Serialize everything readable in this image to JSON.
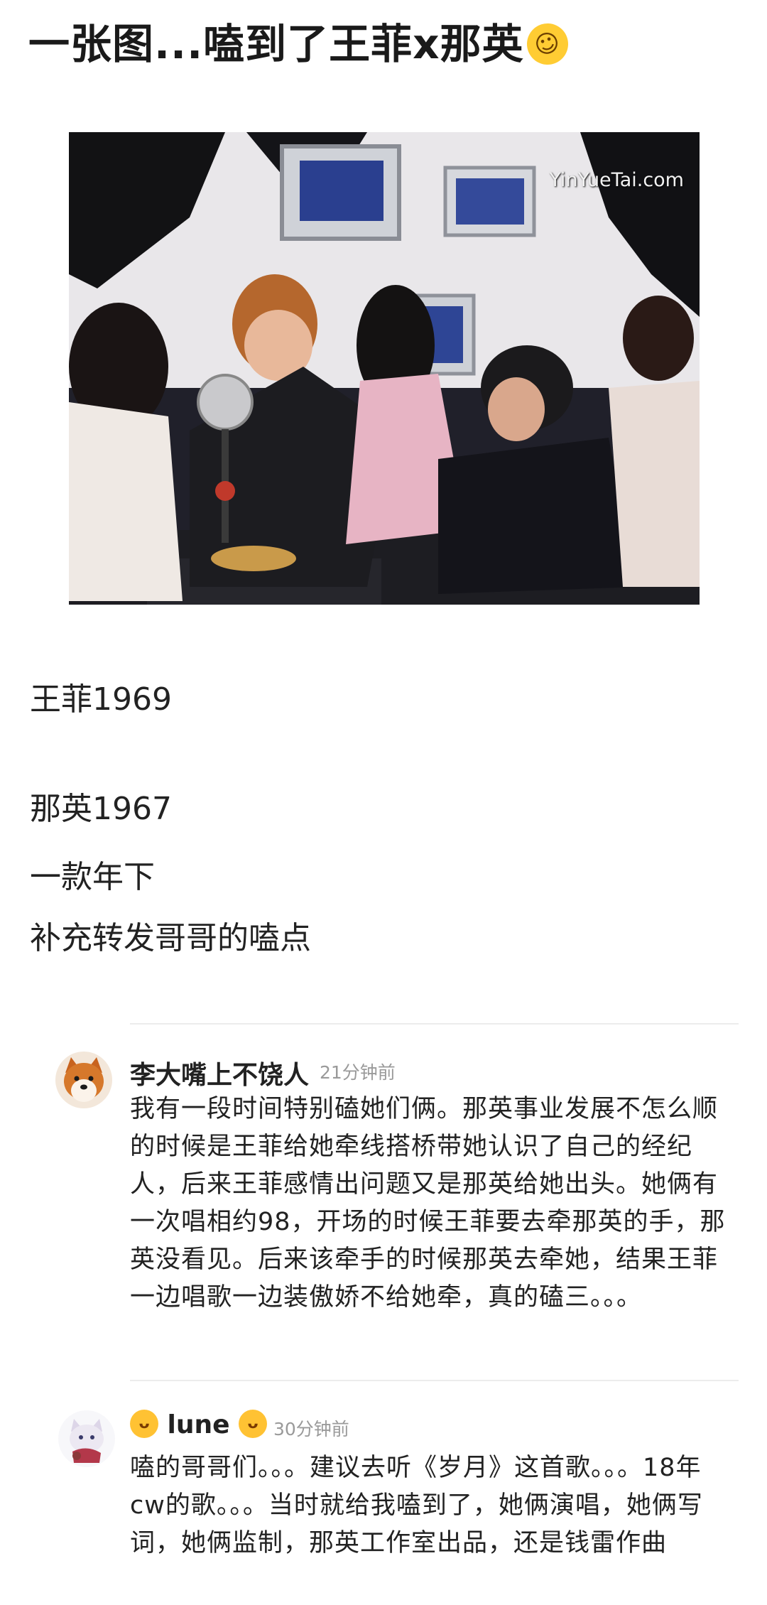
{
  "post": {
    "title": "一张图...嗑到了王菲x那英",
    "title_emoji": "rolling-on-floor-laughing-emoji",
    "photo_watermark": "YinYueTai.com",
    "lines": [
      "王菲1969",
      "那英1967",
      "一款年下",
      "补充转发哥哥的嗑点"
    ]
  },
  "comments": [
    {
      "username": "李大嘴上不饶人",
      "time": "21分钟前",
      "avatar": "shiba-dog-avatar",
      "text": "我有一段时间特别磕她们俩。那英事业发展不怎么顺的时候是王菲给她牵线搭桥带她认识了自己的经纪人，后来王菲感情出问题又是那英给她出头。她俩有一次唱相约98，开场的时候王菲要去牵那英的手，那英没看见。后来该牵手的时候那英去牵她，结果王菲一边唱歌一边装傲娇不给她牵，真的磕三。。。"
    },
    {
      "username": "lune",
      "time": "30分钟前",
      "avatar": "cartoon-cat-avatar",
      "name_emoji": "yawning-face-emoji",
      "text": "嗑的哥哥们。。。建议去听《岁月》这首歌。。。18年cw的歌。。。当时就给我嗑到了，她俩演唱，她俩写词，她俩监制，那英工作室出品，还是钱雷作曲"
    }
  ],
  "colors": {
    "text": "#1a1a1a",
    "muted": "#9a9a9a",
    "divider": "#ececec",
    "emoji": "#ffcc33"
  }
}
